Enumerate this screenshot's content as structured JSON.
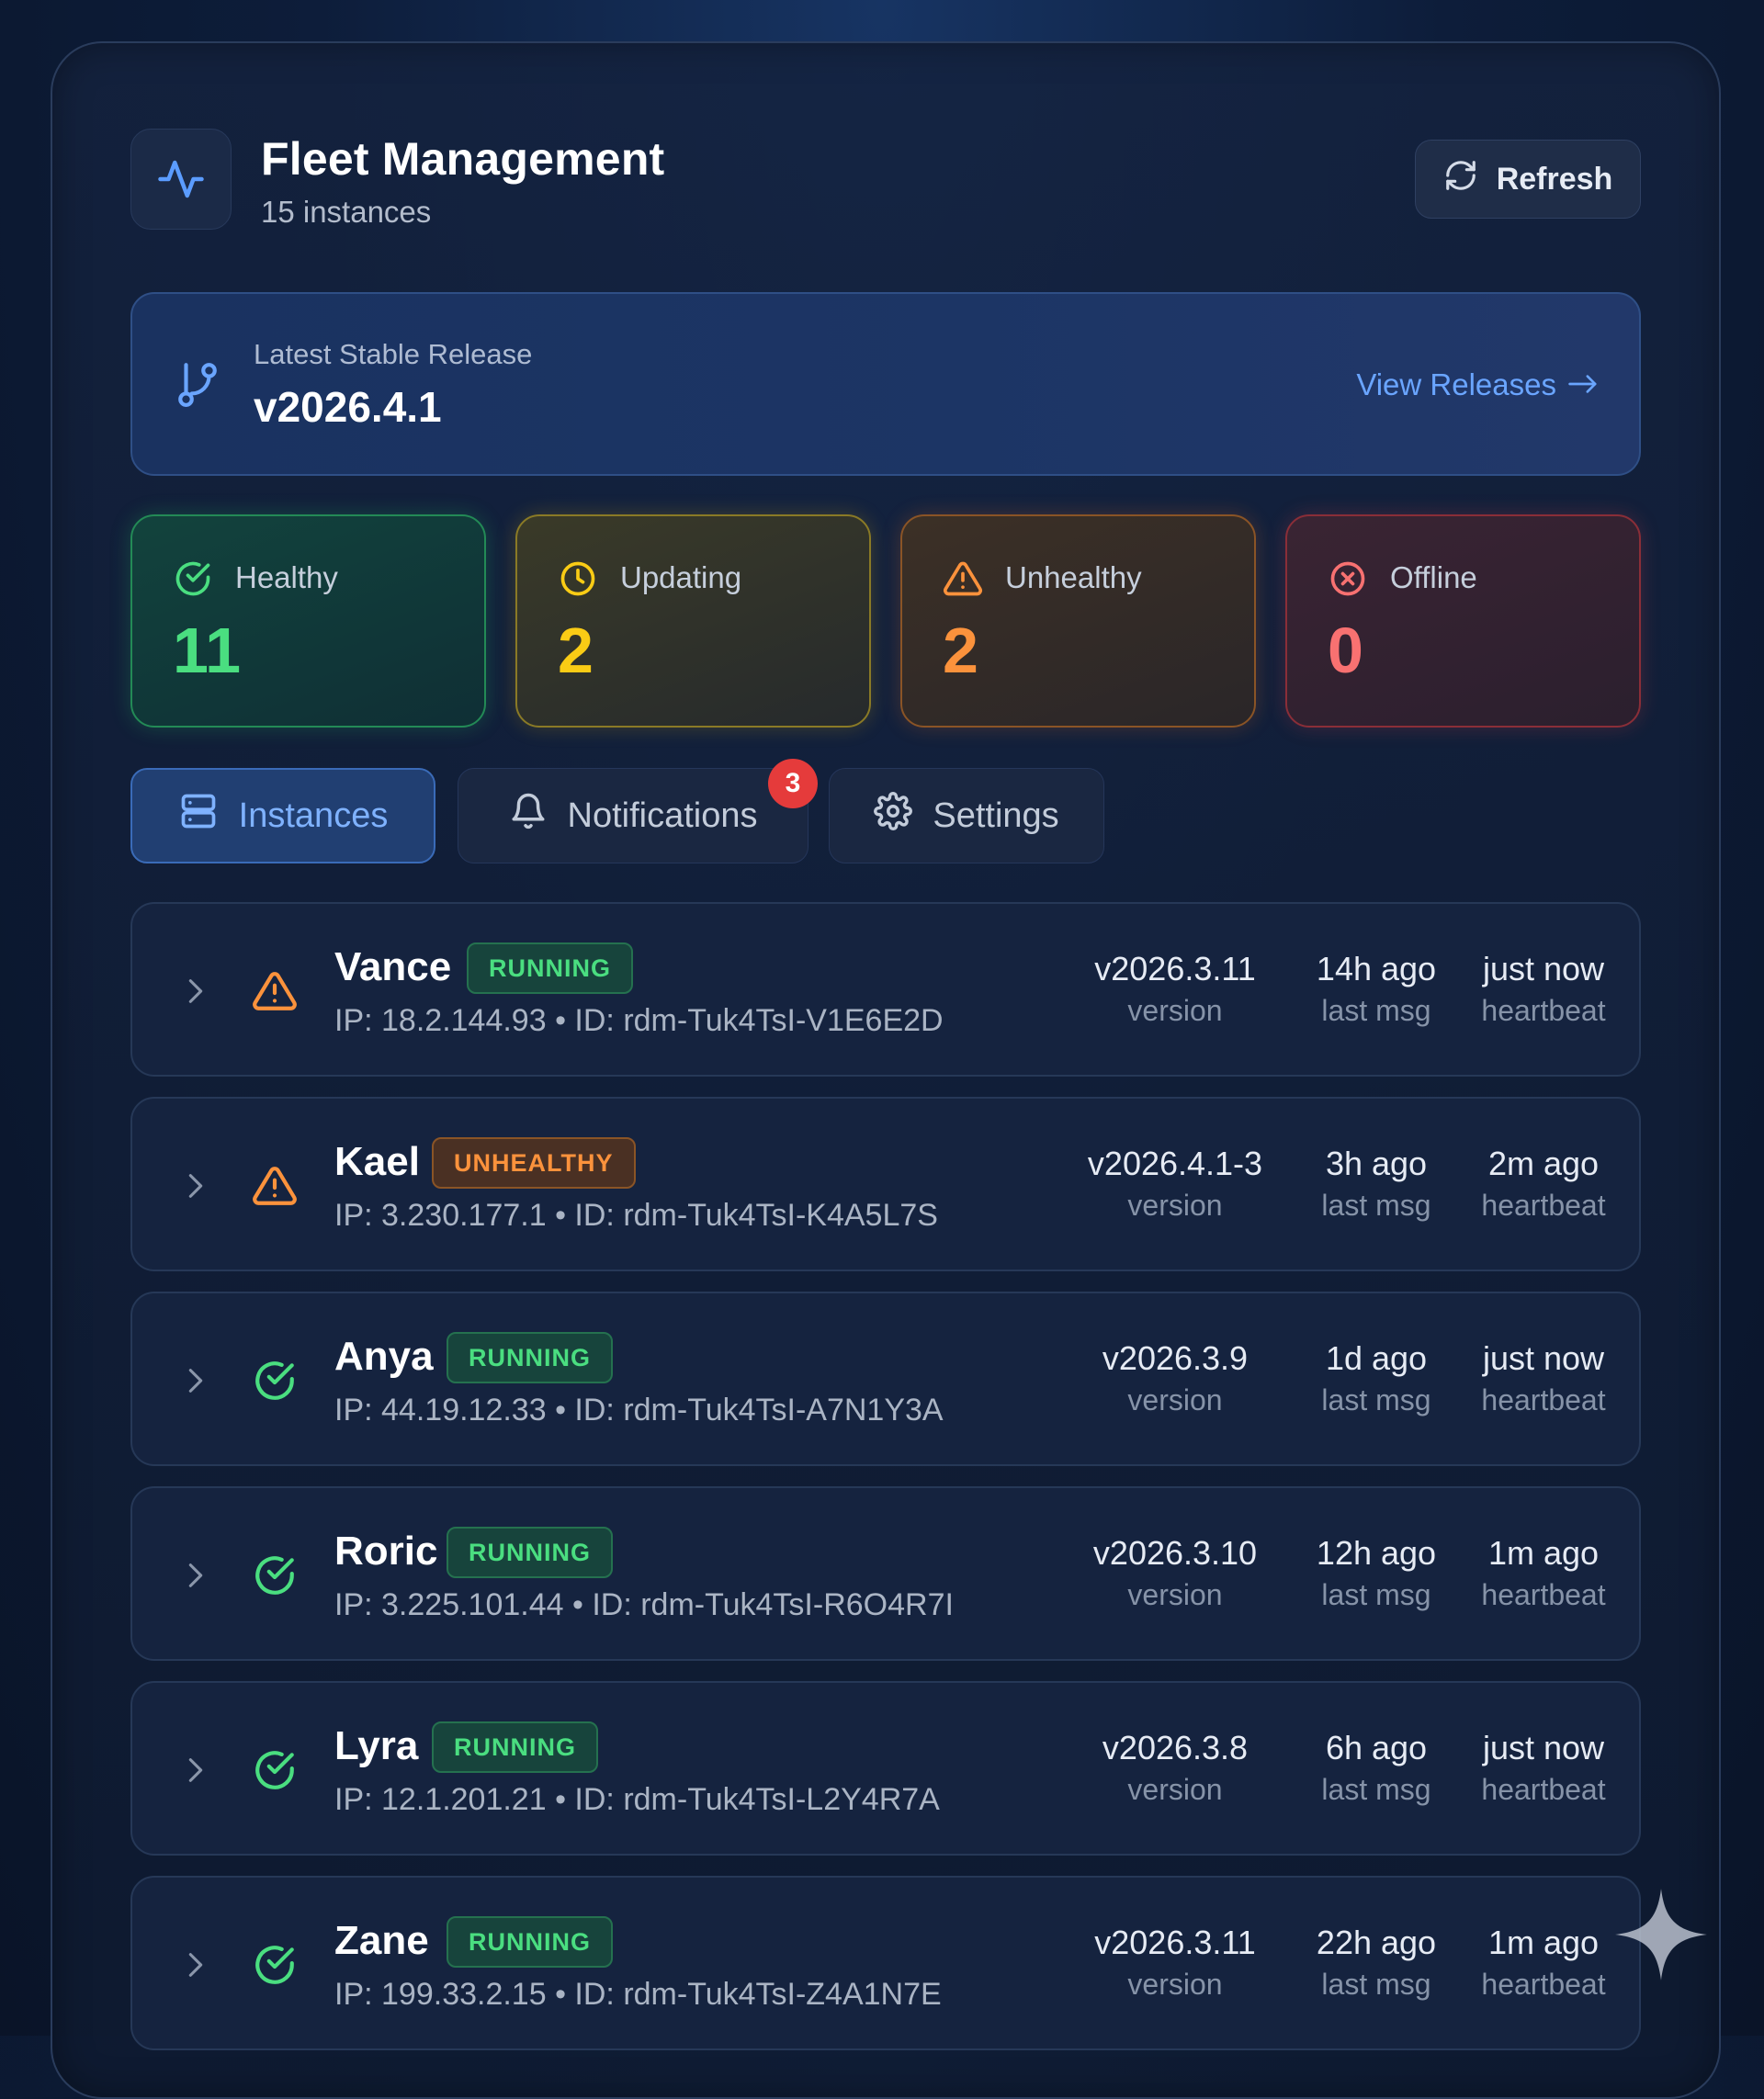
{
  "header": {
    "title": "Fleet Management",
    "subtitle": "15 instances",
    "refresh_label": "Refresh"
  },
  "release": {
    "label": "Latest Stable Release",
    "version": "v2026.4.1",
    "link_label": "View Releases"
  },
  "stats": {
    "healthy": {
      "label": "Healthy",
      "value": "11",
      "color": "#4ade80"
    },
    "updating": {
      "label": "Updating",
      "value": "2",
      "color": "#facc15"
    },
    "unhealthy": {
      "label": "Unhealthy",
      "value": "2",
      "color": "#fb923c"
    },
    "offline": {
      "label": "Offline",
      "value": "0",
      "color": "#f87171"
    }
  },
  "tabs": {
    "instances": "Instances",
    "notifications": "Notifications",
    "notifications_badge": "3",
    "settings": "Settings"
  },
  "labels": {
    "version": "version",
    "last_msg": "last msg",
    "heartbeat": "heartbeat"
  },
  "instances": [
    {
      "name": "Vance",
      "status": "RUNNING",
      "health": "warning",
      "meta": "IP: 18.2.144.93 • ID: rdm-Tuk4TsI-V1E6E2D",
      "version": "v2026.3.11",
      "last_msg": "14h ago",
      "heartbeat": "just now"
    },
    {
      "name": "Kael",
      "status": "UNHEALTHY",
      "health": "warning",
      "meta": "IP: 3.230.177.1 • ID: rdm-Tuk4TsI-K4A5L7S",
      "version": "v2026.4.1-3",
      "last_msg": "3h ago",
      "heartbeat": "2m ago"
    },
    {
      "name": "Anya",
      "status": "RUNNING",
      "health": "ok",
      "meta": "IP: 44.19.12.33 • ID: rdm-Tuk4TsI-A7N1Y3A",
      "version": "v2026.3.9",
      "last_msg": "1d ago",
      "heartbeat": "just now"
    },
    {
      "name": "Roric",
      "status": "RUNNING",
      "health": "ok",
      "meta": "IP: 3.225.101.44 • ID: rdm-Tuk4TsI-R6O4R7I",
      "version": "v2026.3.10",
      "last_msg": "12h ago",
      "heartbeat": "1m ago"
    },
    {
      "name": "Lyra",
      "status": "RUNNING",
      "health": "ok",
      "meta": "IP: 12.1.201.21 • ID: rdm-Tuk4TsI-L2Y4R7A",
      "version": "v2026.3.8",
      "last_msg": "6h ago",
      "heartbeat": "just now"
    },
    {
      "name": "Zane",
      "status": "RUNNING",
      "health": "ok",
      "meta": "IP: 199.33.2.15 • ID: rdm-Tuk4TsI-Z4A1N7E",
      "version": "v2026.3.11",
      "last_msg": "22h ago",
      "heartbeat": "1m ago"
    }
  ],
  "colors": {
    "accent": "#6aa5ff",
    "ok": "#4ade80",
    "warning": "#fb923c"
  }
}
